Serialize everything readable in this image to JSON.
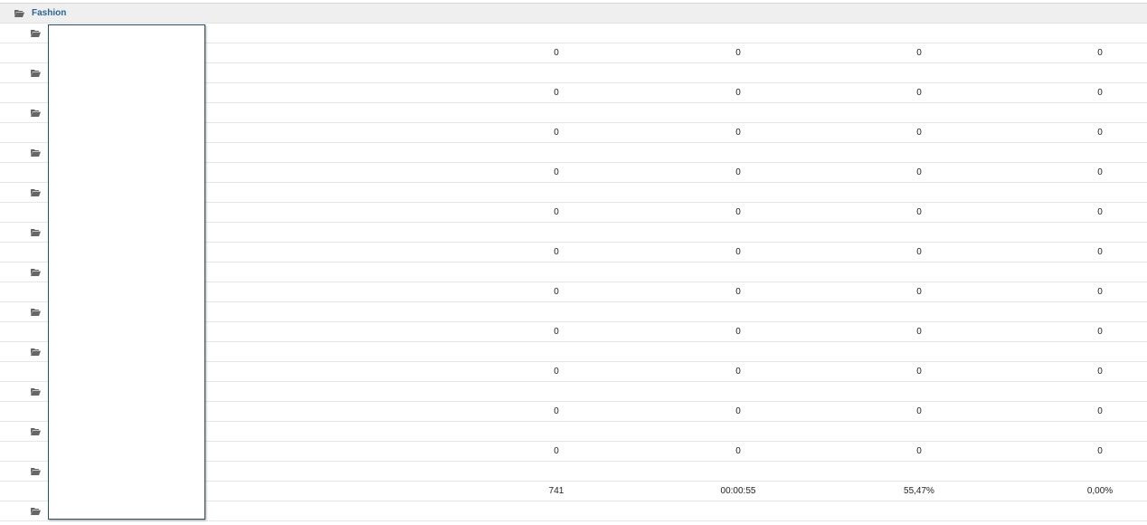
{
  "group": {
    "label": "Fashion",
    "icon": "folder-open-icon"
  },
  "subitem_icon": "folder-open-icon",
  "metric_rows": [
    {
      "c1": "0",
      "c2": "0",
      "c3": "0",
      "c4": "0"
    },
    {
      "c1": "0",
      "c2": "0",
      "c3": "0",
      "c4": "0"
    },
    {
      "c1": "0",
      "c2": "0",
      "c3": "0",
      "c4": "0"
    },
    {
      "c1": "0",
      "c2": "0",
      "c3": "0",
      "c4": "0"
    },
    {
      "c1": "0",
      "c2": "0",
      "c3": "0",
      "c4": "0"
    },
    {
      "c1": "0",
      "c2": "0",
      "c3": "0",
      "c4": "0"
    },
    {
      "c1": "0",
      "c2": "0",
      "c3": "0",
      "c4": "0"
    },
    {
      "c1": "0",
      "c2": "0",
      "c3": "0",
      "c4": "0"
    },
    {
      "c1": "0",
      "c2": "0",
      "c3": "0",
      "c4": "0"
    },
    {
      "c1": "0",
      "c2": "0",
      "c3": "0",
      "c4": "0"
    },
    {
      "c1": "0",
      "c2": "0",
      "c3": "0",
      "c4": "0"
    },
    {
      "c1": "741",
      "c2": "00:00:55",
      "c3": "55,47%",
      "c4": "0,00%"
    }
  ],
  "colors": {
    "link": "#2a6496",
    "header_bg": "#efefef",
    "icon": "#666666"
  }
}
